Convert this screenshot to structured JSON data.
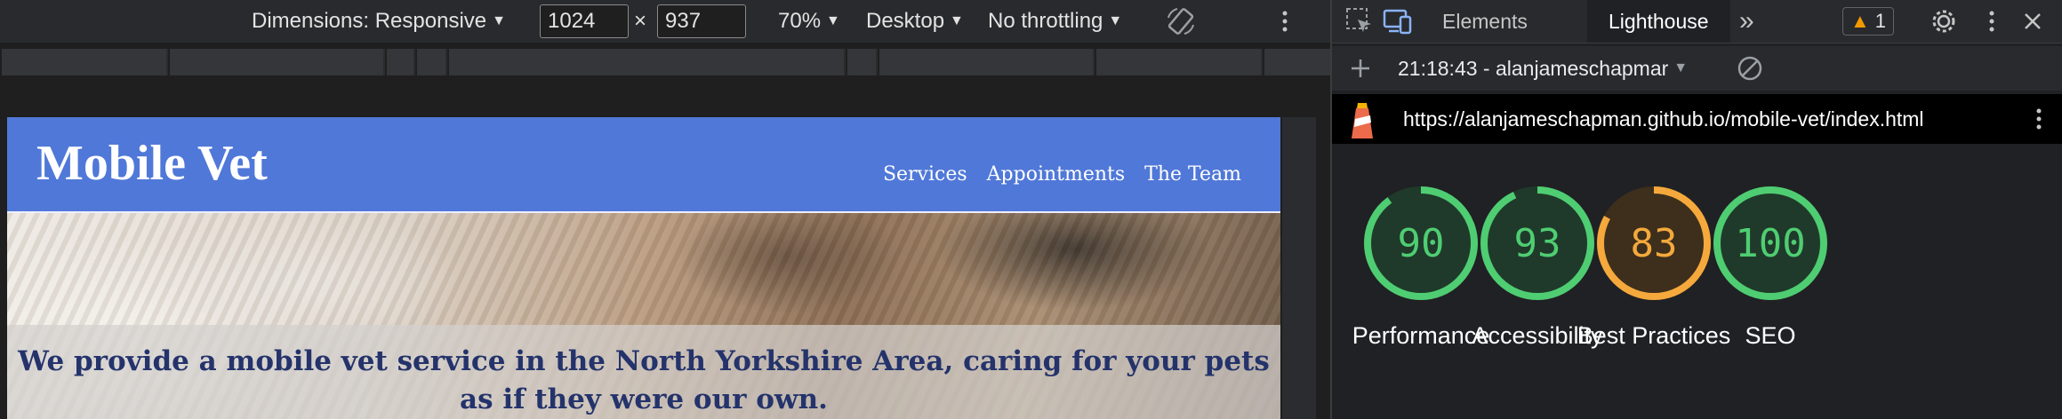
{
  "device_toolbar": {
    "dimensions_label": "Dimensions: Responsive",
    "width_value": "1024",
    "times_symbol": "×",
    "height_value": "937",
    "zoom_label": "70%",
    "device_type_label": "Desktop",
    "throttling_label": "No throttling"
  },
  "site": {
    "title": "Mobile Vet",
    "nav": [
      "Services",
      "Appointments",
      "The Team"
    ],
    "hero_text": "We provide a mobile vet service in the North Yorkshire Area, caring for your pets as if they were our own."
  },
  "devtools": {
    "tabs": {
      "elements": "Elements",
      "lighthouse": "Lighthouse",
      "more": "»"
    },
    "warning_count": "1",
    "report_label": "21:18:43 - alanjameschapmar",
    "url": "https://alanjameschapman.github.io/mobile-vet/index.html"
  },
  "lighthouse_scores": [
    {
      "label": "Performance",
      "value": 90,
      "color": "#0cce6b"
    },
    {
      "label": "Accessibility",
      "value": 93,
      "color": "#0cce6b"
    },
    {
      "label": "Best Practices",
      "value": 83,
      "color": "#ffa400"
    },
    {
      "label": "SEO",
      "value": 100,
      "color": "#0cce6b"
    }
  ],
  "colors": {
    "site_header": "#5078d8",
    "hero_text": "#24336b",
    "pass": "#4fcd72",
    "average": "#f5a93c"
  }
}
